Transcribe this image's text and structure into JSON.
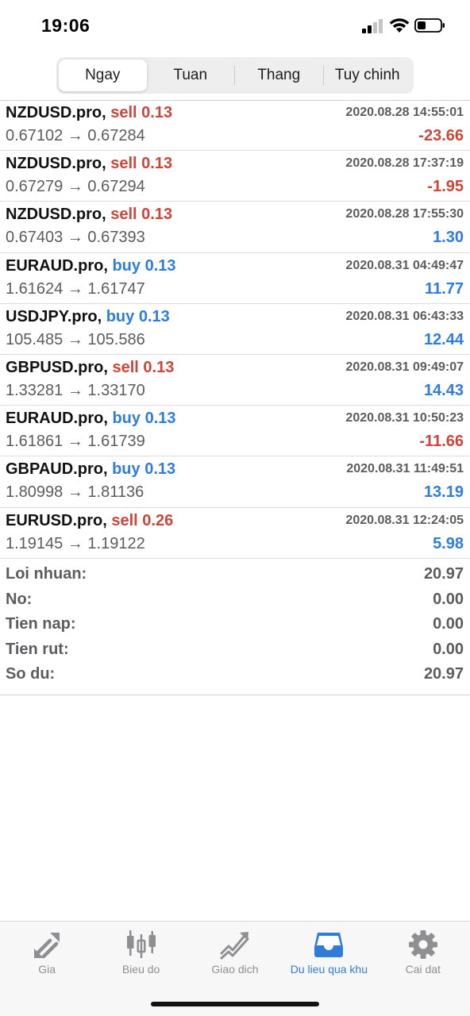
{
  "status_bar": {
    "time": "19:06"
  },
  "segments": [
    {
      "label": "Ngay",
      "active": true
    },
    {
      "label": "Tuan",
      "active": false
    },
    {
      "label": "Thang",
      "active": false
    },
    {
      "label": "Tuy chinh",
      "active": false
    }
  ],
  "deals": [
    {
      "symbol": "NZDUSD.pro,",
      "side": "sell 0.13",
      "time": "2020.08.28 14:55:01",
      "prices": "0.67102 → 0.67284",
      "profit": "-23.66"
    },
    {
      "symbol": "NZDUSD.pro,",
      "side": "sell 0.13",
      "time": "2020.08.28 17:37:19",
      "prices": "0.67279 → 0.67294",
      "profit": "-1.95"
    },
    {
      "symbol": "NZDUSD.pro,",
      "side": "sell 0.13",
      "time": "2020.08.28 17:55:30",
      "prices": "0.67403 → 0.67393",
      "profit": "1.30"
    },
    {
      "symbol": "EURAUD.pro,",
      "side": "buy 0.13",
      "time": "2020.08.31 04:49:47",
      "prices": "1.61624 → 1.61747",
      "profit": "11.77"
    },
    {
      "symbol": "USDJPY.pro,",
      "side": "buy 0.13",
      "time": "2020.08.31 06:43:33",
      "prices": "105.485 → 105.586",
      "profit": "12.44"
    },
    {
      "symbol": "GBPUSD.pro,",
      "side": "sell 0.13",
      "time": "2020.08.31 09:49:07",
      "prices": "1.33281 → 1.33170",
      "profit": "14.43"
    },
    {
      "symbol": "EURAUD.pro,",
      "side": "buy 0.13",
      "time": "2020.08.31 10:50:23",
      "prices": "1.61861 → 1.61739",
      "profit": "-11.66"
    },
    {
      "symbol": "GBPAUD.pro,",
      "side": "buy 0.13",
      "time": "2020.08.31 11:49:51",
      "prices": "1.80998 → 1.81136",
      "profit": "13.19"
    },
    {
      "symbol": "EURUSD.pro,",
      "side": "sell 0.26",
      "time": "2020.08.31 12:24:05",
      "prices": "1.19145 → 1.19122",
      "profit": "5.98"
    }
  ],
  "summary": [
    {
      "label": "Loi nhuan:",
      "value": "20.97"
    },
    {
      "label": "No:",
      "value": "0.00"
    },
    {
      "label": "Tien nap:",
      "value": "0.00"
    },
    {
      "label": "Tien rut:",
      "value": "0.00"
    },
    {
      "label": "So du:",
      "value": "20.97"
    }
  ],
  "tabs": [
    {
      "label": "Gia",
      "icon": "quotes-arrows-icon",
      "active": false
    },
    {
      "label": "Bieu do",
      "icon": "candlestick-chart-icon",
      "active": false
    },
    {
      "label": "Giao dich",
      "icon": "trade-trend-icon",
      "active": false
    },
    {
      "label": "Du lieu qua khu",
      "icon": "history-inbox-icon",
      "active": true
    },
    {
      "label": "Cai dat",
      "icon": "gear-icon",
      "active": false
    }
  ],
  "colors": {
    "sell": "#c8463a",
    "buy": "#2f7dd8",
    "inactive_tab": "#8e8e93",
    "active_tab": "#2f7dd8"
  }
}
